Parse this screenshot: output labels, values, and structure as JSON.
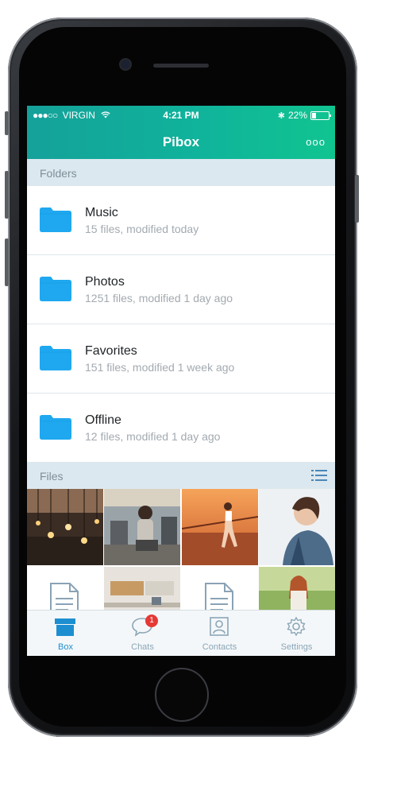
{
  "status_bar": {
    "carrier": "VIRGIN",
    "signal_dots": "●●●○○",
    "time": "4:21 PM",
    "battery": "22%"
  },
  "nav": {
    "title": "Pibox",
    "more_label": "ooo"
  },
  "folders_section": {
    "title": "Folders"
  },
  "folders": [
    {
      "name": "Music",
      "meta": "15 files, modified today"
    },
    {
      "name": "Photos",
      "meta": "1251 files, modified 1 day ago"
    },
    {
      "name": "Favorites",
      "meta": "151 files, modified 1 week ago"
    },
    {
      "name": "Offline",
      "meta": "12 files, modified 1 day ago"
    }
  ],
  "files_section": {
    "title": "Files"
  },
  "tabs": [
    {
      "label": "Box",
      "icon": "box-icon",
      "active": true
    },
    {
      "label": "Chats",
      "icon": "chat-icon",
      "badge": "1"
    },
    {
      "label": "Contacts",
      "icon": "contact-icon"
    },
    {
      "label": "Settings",
      "icon": "gear-icon"
    }
  ],
  "colors": {
    "accent": "#10b39b",
    "folder": "#1fa8f0",
    "active_tab": "#1d8fd1",
    "badge": "#e53935"
  }
}
